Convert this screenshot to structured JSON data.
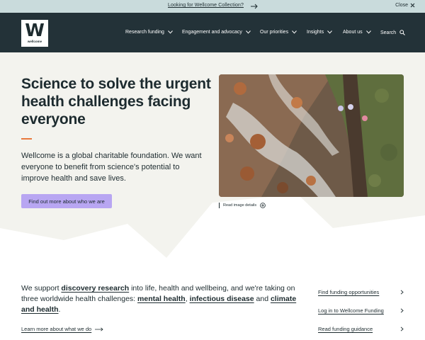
{
  "notice": {
    "link_label": "Looking for Wellcome Collection?",
    "close_label": "Close"
  },
  "header": {
    "logo_letter": "W",
    "logo_text": "wellcome",
    "nav": [
      {
        "label": "Research funding"
      },
      {
        "label": "Engagement and advocacy"
      },
      {
        "label": "Our priorities"
      },
      {
        "label": "Insights"
      },
      {
        "label": "About us"
      }
    ],
    "search_label": "Search"
  },
  "hero": {
    "title": "Science to solve the urgent health challenges facing everyone",
    "description": "Wellcome is a global charitable foundation. We want everyone to benefit from science's potential to improve health and save lives.",
    "cta_label": "Find out more about who we are",
    "image_details_label": "Read image details"
  },
  "support": {
    "t1": "We support ",
    "l1": "discovery research",
    "t2": " into life, health and wellbeing, and we're taking on three worldwide health challenges: ",
    "l2": "mental health",
    "t3": ", ",
    "l3": "infectious disease",
    "t4": " and ",
    "l4": "climate and health",
    "t5": "."
  },
  "learn_more_label": "Learn more about what we do",
  "side_links": [
    {
      "label": "Find funding opportunities"
    },
    {
      "label": "Log in to Wellcome Funding"
    },
    {
      "label": "Read funding guidance"
    }
  ],
  "colors": {
    "header_bg": "#233238",
    "notice_bg": "#c9dbdc",
    "hero_bg": "#f3f3ee",
    "accent": "#e8783c",
    "cta_bg": "#b8a6f2",
    "text": "#1d2b2f"
  },
  "icons": [
    "arrow-right-icon",
    "close-icon",
    "chevron-down-icon",
    "search-icon",
    "plus-circle-icon",
    "chevron-right-icon"
  ]
}
